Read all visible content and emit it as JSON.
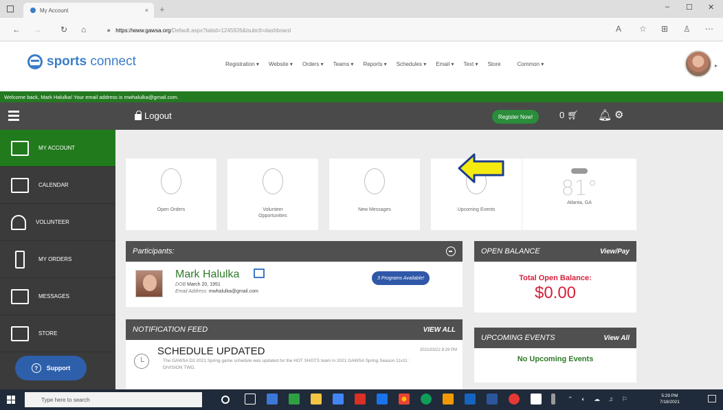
{
  "browser": {
    "tab_title": "My Account",
    "tab_close": "×",
    "new_tab": "+",
    "url_host": "https://www.gawsa.org",
    "url_rest": "/Default.aspx?tabid=1245926&isubctl=dashboard",
    "win_min": "–",
    "win_max": "☐",
    "win_close": "✕"
  },
  "site": {
    "logo_bold": "sports",
    "logo_light": " connect",
    "nav": [
      "Registration ▾",
      "Website ▾",
      "Orders ▾",
      "Teams ▾",
      "Reports ▾",
      "Schedules ▾",
      "Email ▾",
      "Text ▾",
      "Store",
      "Common ▾"
    ],
    "welcome": "Welcome back, Mark Halulka! Your email address is mwhalulka@gmail.com.",
    "logout": "Logout",
    "register": "Register Now!",
    "cart_count": "0"
  },
  "sidebar": {
    "items": [
      {
        "label": "MY ACCOUNT",
        "icon": "monitor-icon"
      },
      {
        "label": "CALENDAR",
        "icon": "calendar-icon"
      },
      {
        "label": "VOLUNTEER",
        "icon": "volunteer-icon"
      },
      {
        "label": "MY ORDERS",
        "icon": "orders-icon"
      },
      {
        "label": "MESSAGES",
        "icon": "messages-icon"
      },
      {
        "label": "STORE",
        "icon": "cart-icon"
      }
    ],
    "support": "Support"
  },
  "stats": [
    {
      "value": "0",
      "label": "Open Orders"
    },
    {
      "value": "0",
      "label": "Volunteer Opportunities"
    },
    {
      "value": "0",
      "label": "New Messages"
    },
    {
      "value": "0",
      "label": "Upcoming Events"
    }
  ],
  "weather": {
    "temp": "81°",
    "city": "Atlanta, GA"
  },
  "participants": {
    "title": "Participants:",
    "name": "Mark Halulka",
    "dob_label": "DOB",
    "dob": "March 20, 1951",
    "email_label": "Email Address:",
    "email": "mwhalulka@gmail.com",
    "programs": "3 Programs Available!"
  },
  "notifications": {
    "title": "NOTIFICATION FEED",
    "view_all": "VIEW ALL",
    "item_title": "SCHEDULE UPDATED",
    "item_time": "2021/03/22 8:29 PM",
    "item_body": "The GAWSA D2 2021 Spring game schedule was updated for the HOT SHOTS team in 2021 GAWSA Spring Season 11v11 : DIVISION TWO."
  },
  "balance": {
    "title": "OPEN BALANCE",
    "view_pay": "View/Pay",
    "label": "Total Open Balance:",
    "amount": "$0.00"
  },
  "upcoming": {
    "title": "UPCOMING EVENTS",
    "view_all": "View All",
    "empty": "No Upcoming Events"
  },
  "taskbar": {
    "search_placeholder": "Type here to search",
    "time": "5:29 PM",
    "date": "7/18/2021"
  },
  "colors": {
    "green": "#247a21",
    "dark": "#4a4a4a",
    "red": "#d4203a",
    "blue": "#2f58a8",
    "arrow": "#f5ea10"
  }
}
